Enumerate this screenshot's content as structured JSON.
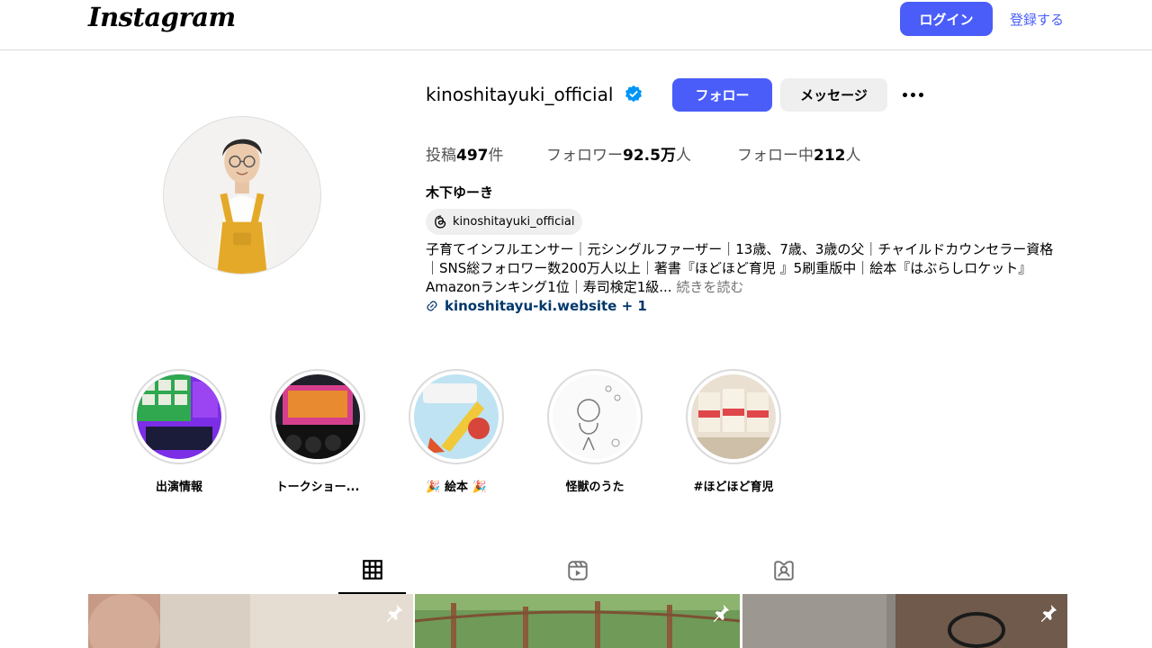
{
  "topbar": {
    "logo_text": "Instagram",
    "login_label": "ログイン",
    "signup_label": "登録する"
  },
  "profile": {
    "username": "kinoshitayuki_official",
    "verified": true,
    "follow_label": "フォロー",
    "message_label": "メッセージ",
    "more_icon": "more-horizontal-icon",
    "stats": {
      "posts_label": "投稿",
      "posts_value": "497",
      "posts_unit": "件",
      "followers_label": "フォロワー",
      "followers_value": "92.5万",
      "followers_unit": "人",
      "following_label": "フォロー中",
      "following_value": "212",
      "following_unit": "人"
    },
    "full_name": "木下ゆーき",
    "threads_handle": "kinoshitayuki_official",
    "bio_text": "子育てインフルエンサー｜元シングルファーザー｜13歳、7歳、3歳の父｜チャイルドカウンセラー資格｜SNS総フォロワー数200万人以上｜著書『ほどほど育児 』5刷重版中｜絵本『はぶらしロケット』Amazonランキング1位｜寿司検定1級...",
    "bio_more": " 続きを読む",
    "website": "kinoshitayu-ki.website + 1"
  },
  "highlights": [
    {
      "label": "出演情報"
    },
    {
      "label": "トークショー..."
    },
    {
      "label": "🎉 絵本 🎉"
    },
    {
      "label": "怪獣のうた"
    },
    {
      "label": "#ほどほど育児"
    }
  ],
  "tabs": [
    {
      "icon": "grid-icon",
      "active": true
    },
    {
      "icon": "reels-icon",
      "active": false
    },
    {
      "icon": "tagged-icon",
      "active": false
    }
  ],
  "posts": [
    {
      "pinned": true
    },
    {
      "pinned": true
    },
    {
      "pinned": true
    }
  ],
  "colors": {
    "accent": "#4a5df9",
    "link": "#00376b",
    "secondary_text": "#737373",
    "button_grey": "#efefef",
    "verified_blue": "#0095f6"
  }
}
